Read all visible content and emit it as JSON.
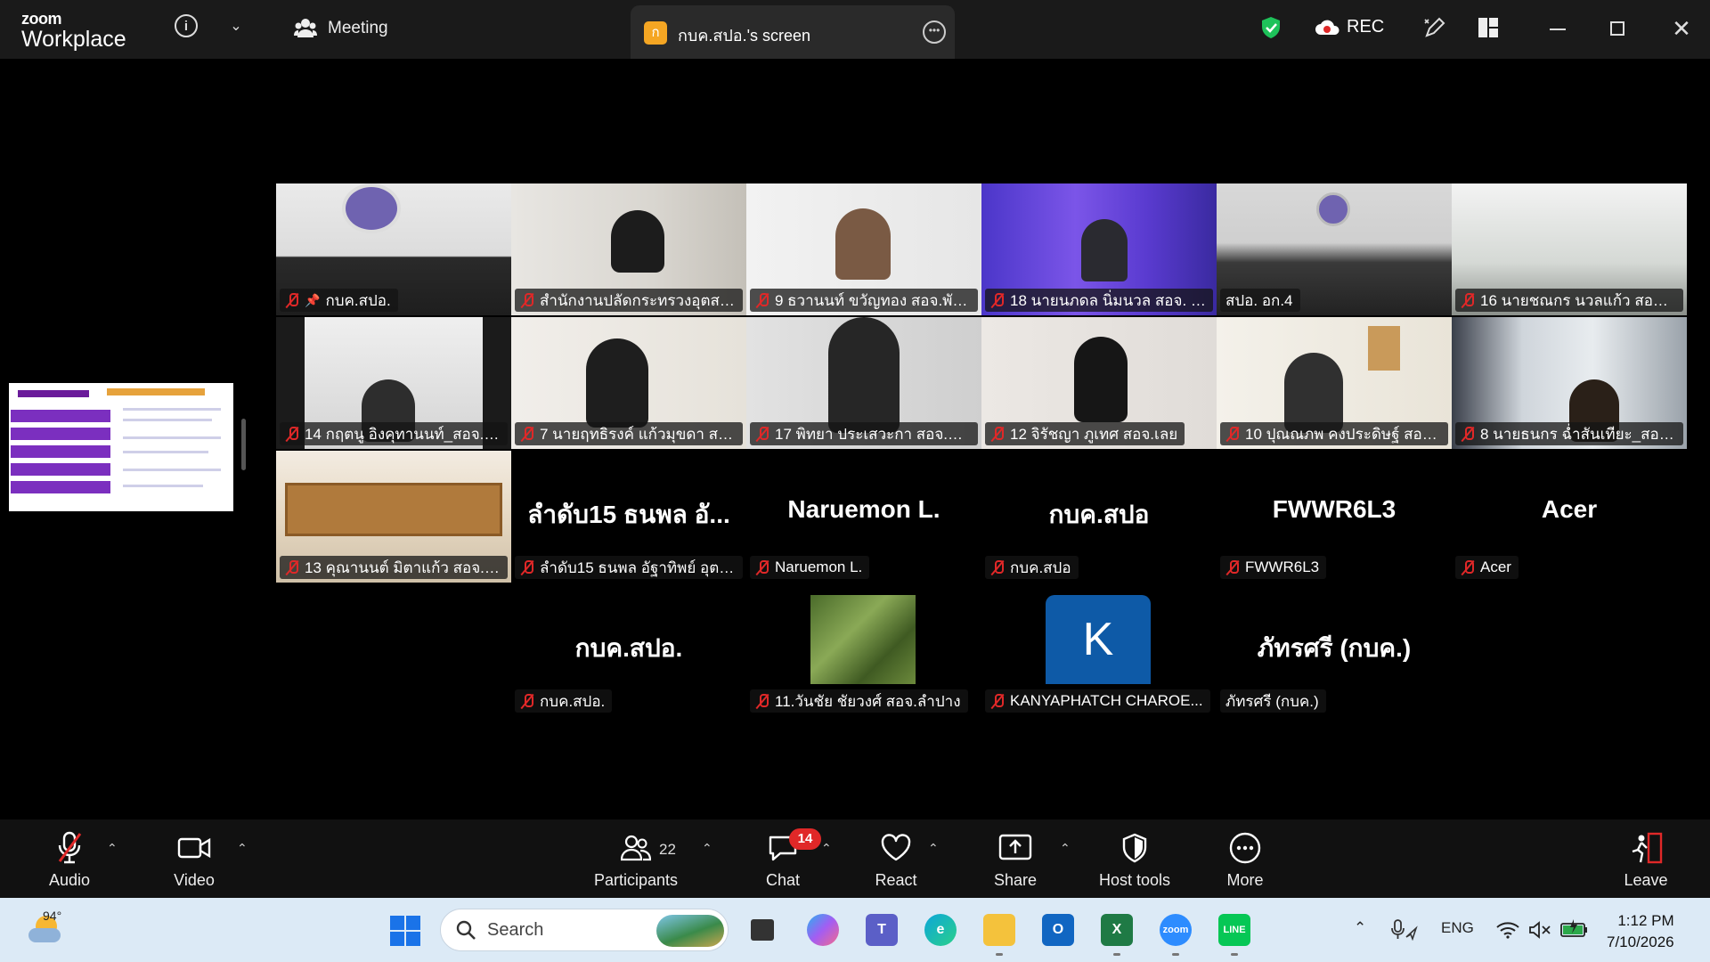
{
  "titlebar": {
    "logo_top": "zoom",
    "logo_bottom": "Workplace",
    "meeting_label": "Meeting",
    "screen_tab_badge": "ก",
    "screen_tab_label": "กบค.สปอ.'s screen",
    "rec_label": "REC",
    "icons": [
      "info-icon",
      "chevron-down-icon",
      "people-icon",
      "more-icon",
      "shield-check-icon",
      "cloud-record-icon",
      "pen-icon",
      "layout-icon",
      "minimize-icon",
      "restore-icon",
      "close-icon"
    ]
  },
  "participants": [
    {
      "label": "กบค.สปอ.",
      "active": true,
      "pinned": true
    },
    {
      "label": "สำนักงานปลัดกระทรวงอุตสาห...",
      "video": true
    },
    {
      "label": "9 ธวานนท์ ขวัญทอง สอจ.พัทลุง",
      "video": true
    },
    {
      "label": "18 นายนภดล นิ่มนวล สอจ. อ...",
      "video": true
    },
    {
      "label": "สปอ. อก.4",
      "video": true,
      "muted": false
    },
    {
      "label": "16 นายชณกร นวลแก้ว สอจ.ส...",
      "video": true
    },
    {
      "label": "14 กฤตนู อิงคุทานนท์_สอจ.สร...",
      "video": true
    },
    {
      "label": "7 นายฤทธิรงค์ แก้วมุขดา สอจ...",
      "video": true
    },
    {
      "label": "17 พิทยา ประเสวะกา สอจ.อุด...",
      "video": true
    },
    {
      "label": "12 จิรัชญา ภูเทศ สอจ.เลย",
      "video": true
    },
    {
      "label": "10 ปุณณภพ คงประดิษฐ์ สอจ....",
      "video": true
    },
    {
      "label": "8 นายธนกร ฉ่ำสันเทียะ_สอจ....",
      "video": true
    },
    {
      "label": "13 คุณานนต์ มิตาแก้ว สอจ.ส...",
      "video": true
    },
    {
      "big": "ลำดับ15 ธนพล อั...",
      "label": "ลำดับ15 ธนพล อัฐาทิพย์ อุตส..."
    },
    {
      "big": "Naruemon L.",
      "label": "Naruemon L."
    },
    {
      "big": "กบค.สปอ",
      "label": "กบค.สปอ"
    },
    {
      "big": "FWWR6L3",
      "label": "FWWR6L3"
    },
    {
      "big": "Acer",
      "label": "Acer"
    },
    {
      "big": "กบค.สปอ.",
      "label": "กบค.สปอ."
    },
    {
      "label": "11.วันชัย ชัยวงศ์ สอจ.ลำปาง",
      "photo": true
    },
    {
      "avatar": "K",
      "label": "KANYAPHATCH CHAROE..."
    },
    {
      "big": "ภัทรศรี (กบค.)",
      "label": "ภัทรศรี (กบค.)",
      "muted": false
    }
  ],
  "toolbar": {
    "audio": "Audio",
    "video": "Video",
    "participants": "Participants",
    "participants_count": "22",
    "chat": "Chat",
    "chat_badge": "14",
    "react": "React",
    "share": "Share",
    "host_tools": "Host tools",
    "more": "More",
    "leave": "Leave"
  },
  "taskbar": {
    "temperature": "94°",
    "search_placeholder": "Search",
    "language": "ENG",
    "time": "1:12 PM",
    "date": "7/10/2026"
  },
  "colors": {
    "active_speaker": "#23d18b",
    "muted_red": "#e02828",
    "chat_badge": "#e02828",
    "avatar_blue": "#0e5aa7"
  }
}
